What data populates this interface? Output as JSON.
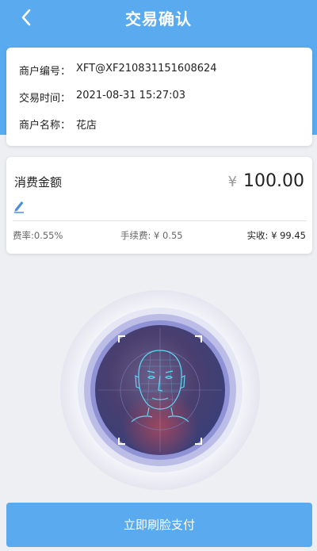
{
  "nav": {
    "title": "交易确认"
  },
  "merchant": {
    "id_label": "商户编号：",
    "id_value": "XFT@XF210831151608624",
    "time_label": "交易时间：",
    "time_value": "2021-08-31 15:27:03",
    "name_label": "商户名称：",
    "name_value": "花店"
  },
  "payment": {
    "label": "消费金额",
    "currency": "¥",
    "amount": "100.00",
    "rate": "费率:0.55%",
    "fee": "手续费: ¥ 0.55",
    "received": "实收: ¥ 99.45"
  },
  "action": {
    "pay_label": "立即刷脸支付"
  },
  "colors": {
    "primary": "#5aaaf0",
    "background": "#eeeff2"
  }
}
